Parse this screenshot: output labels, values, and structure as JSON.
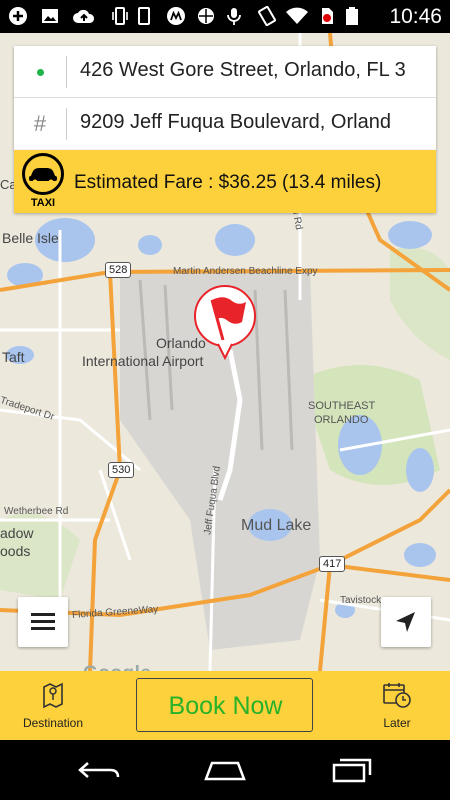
{
  "status_bar": {
    "time": "10:46",
    "icons": [
      "add-icon",
      "image-icon",
      "cloud-upload-icon",
      "vibrate-icon",
      "motorola-icon",
      "sync-icon",
      "mic-icon",
      "rotate-icon",
      "wifi-icon",
      "no-sim-icon",
      "battery-icon"
    ]
  },
  "trip": {
    "pickup_address": "426 West Gore Street, Orlando, FL 3",
    "destination_address": "9209 Jeff Fuqua Boulevard, Orland",
    "fare_text": "Estimated Fare : $36.25 (13.4 miles)",
    "taxi_label": "TAXI"
  },
  "map": {
    "labels": {
      "belle_isle": "Belle Isle",
      "taft": "Taft",
      "orlando": "Orlando",
      "airport": "International Airport",
      "southeast": "SOUTHEAST",
      "southeast_orlando": "ORLANDO",
      "mud_lake": "Mud Lake",
      "beachline": "Martin Andersen Beachline Expy",
      "tradeport": "Tradeport Dr",
      "wetherbee": "Wetherbee Rd",
      "jeff_fuqua": "Jeff Fuqua Blvd",
      "greeneway": "Florida GreeneWay",
      "tavistock": "Tavistock",
      "adow": "adow",
      "oods": "oods",
      "cas": "Cas",
      "od_rd": "od Rd",
      "google": "Google"
    },
    "shields": {
      "r528": "528",
      "r530": "530",
      "r417": "417"
    }
  },
  "bottom_bar": {
    "destination_label": "Destination",
    "book_now_label": "Book Now",
    "later_label": "Later"
  },
  "colors": {
    "accent_yellow": "#fdd13b",
    "book_green": "#28b22a",
    "pickup_dot": "#1db346",
    "pin_red": "#e8232a"
  }
}
